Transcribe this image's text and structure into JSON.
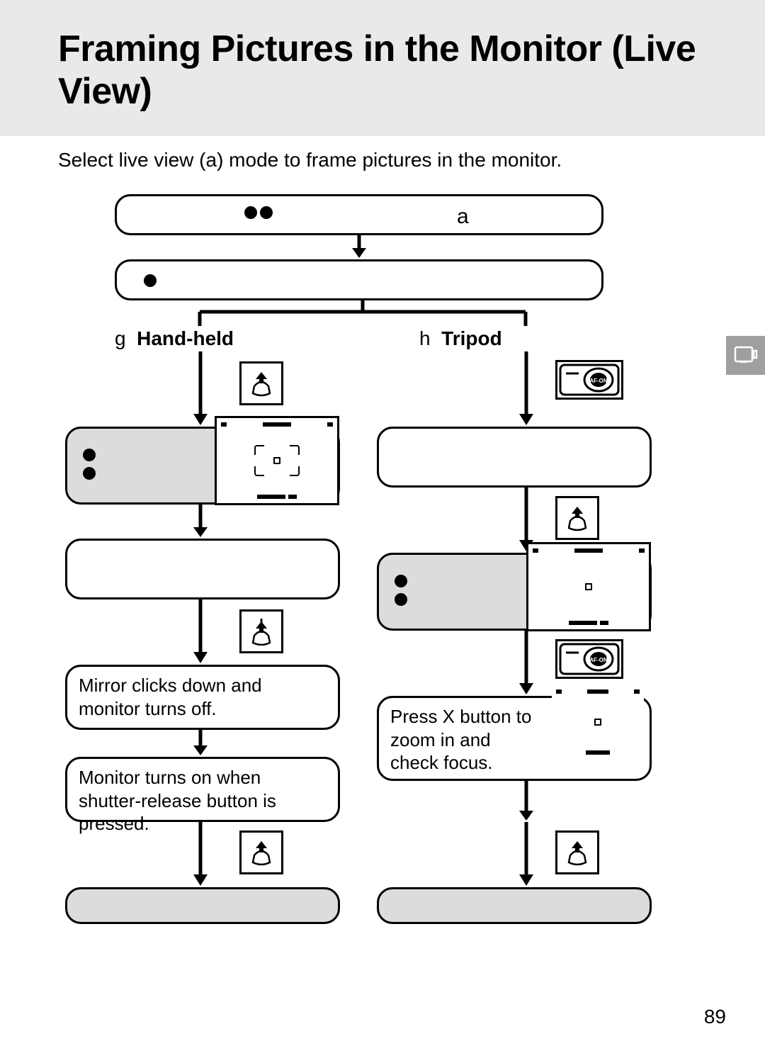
{
  "page": {
    "title": "Framing Pictures in the Monitor (Live View)",
    "intro": "Select live view (a) mode to frame pictures in the monitor.",
    "pageNumber": "89"
  },
  "topGlyph": "a",
  "modes": {
    "left": {
      "prefix": "g",
      "label": "Hand-held"
    },
    "right": {
      "prefix": "h",
      "label": "Tripod"
    }
  },
  "left": {
    "mirror": "Mirror clicks down and monitor turns off.",
    "monitor": "Monitor turns on when shutter-release button is pressed."
  },
  "right": {
    "zoom": "Press X button to zoom in and check focus."
  }
}
